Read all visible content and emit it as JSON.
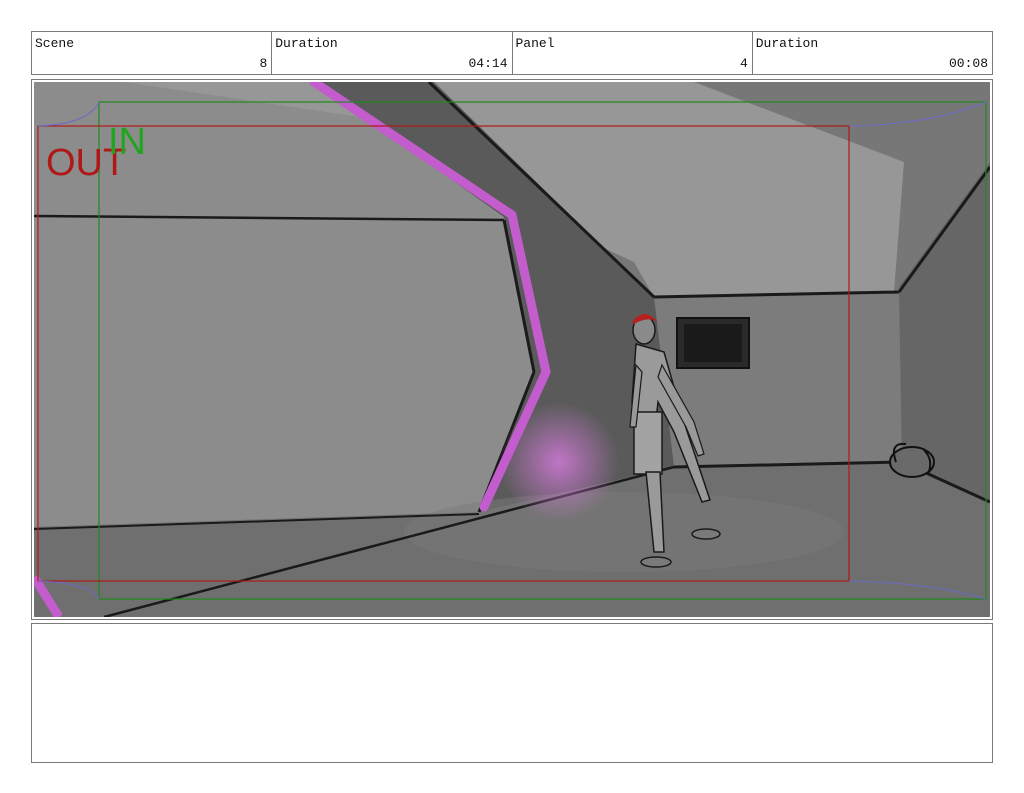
{
  "header": {
    "scene_label": "Scene",
    "scene_value": "8",
    "scene_duration_label": "Duration",
    "scene_duration_value": "04:14",
    "panel_label": "Panel",
    "panel_value": "4",
    "panel_duration_label": "Duration",
    "panel_duration_value": "00:08"
  },
  "frame": {
    "in_label": "IN",
    "out_label": "OUT",
    "in_color": "#1fa51f",
    "out_color": "#b01818",
    "camera_path_color": "#c35ccc"
  },
  "notes": {
    "text": ""
  }
}
